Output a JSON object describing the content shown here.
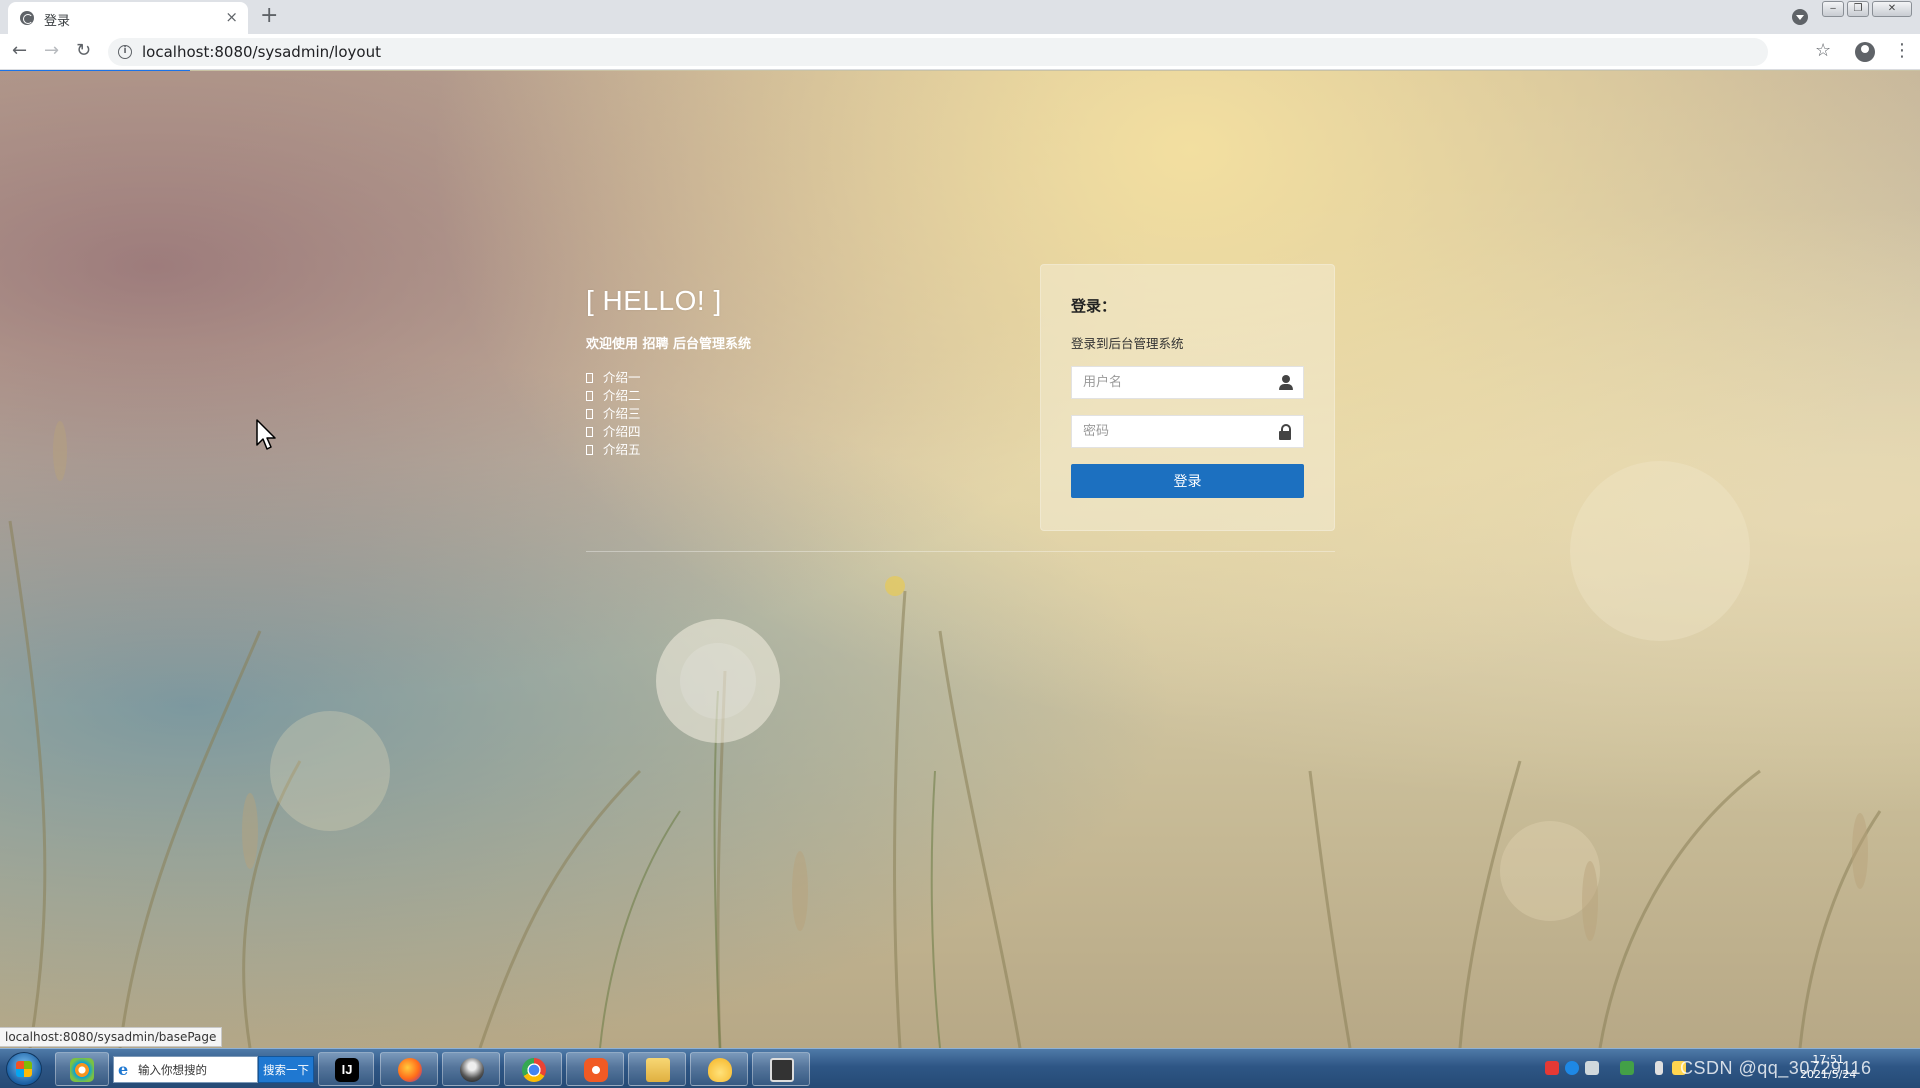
{
  "browser": {
    "tab_title": "登录",
    "tab_close": "×",
    "new_tab": "+",
    "url": "localhost:8080/sysadmin/loyout",
    "status_url": "localhost:8080/sysadmin/basePage"
  },
  "intro": {
    "hello": "[ HELLO! ]",
    "welcome": "欢迎使用 招聘 后台管理系统",
    "items": [
      "介绍一",
      "介绍二",
      "介绍三",
      "介绍四",
      "介绍五"
    ]
  },
  "login": {
    "title": "登录：",
    "subtitle": "登录到后台管理系统",
    "username_placeholder": "用户名",
    "password_placeholder": "密码",
    "submit_label": "登录",
    "button_color": "#1c70c0"
  },
  "taskbar": {
    "search_placeholder": "输入你想搜的",
    "search_button": "搜索一下",
    "watermark": "CSDN @qq_30729116",
    "clock_time": "17:51",
    "clock_date": "2021/5/24",
    "apps": [
      "flower-icon",
      "intellij-icon",
      "firefox-icon",
      "inkscape-icon",
      "chrome-icon",
      "settings-app-icon",
      "file-explorer-icon",
      "folder-icon",
      "terminal-icon"
    ]
  }
}
